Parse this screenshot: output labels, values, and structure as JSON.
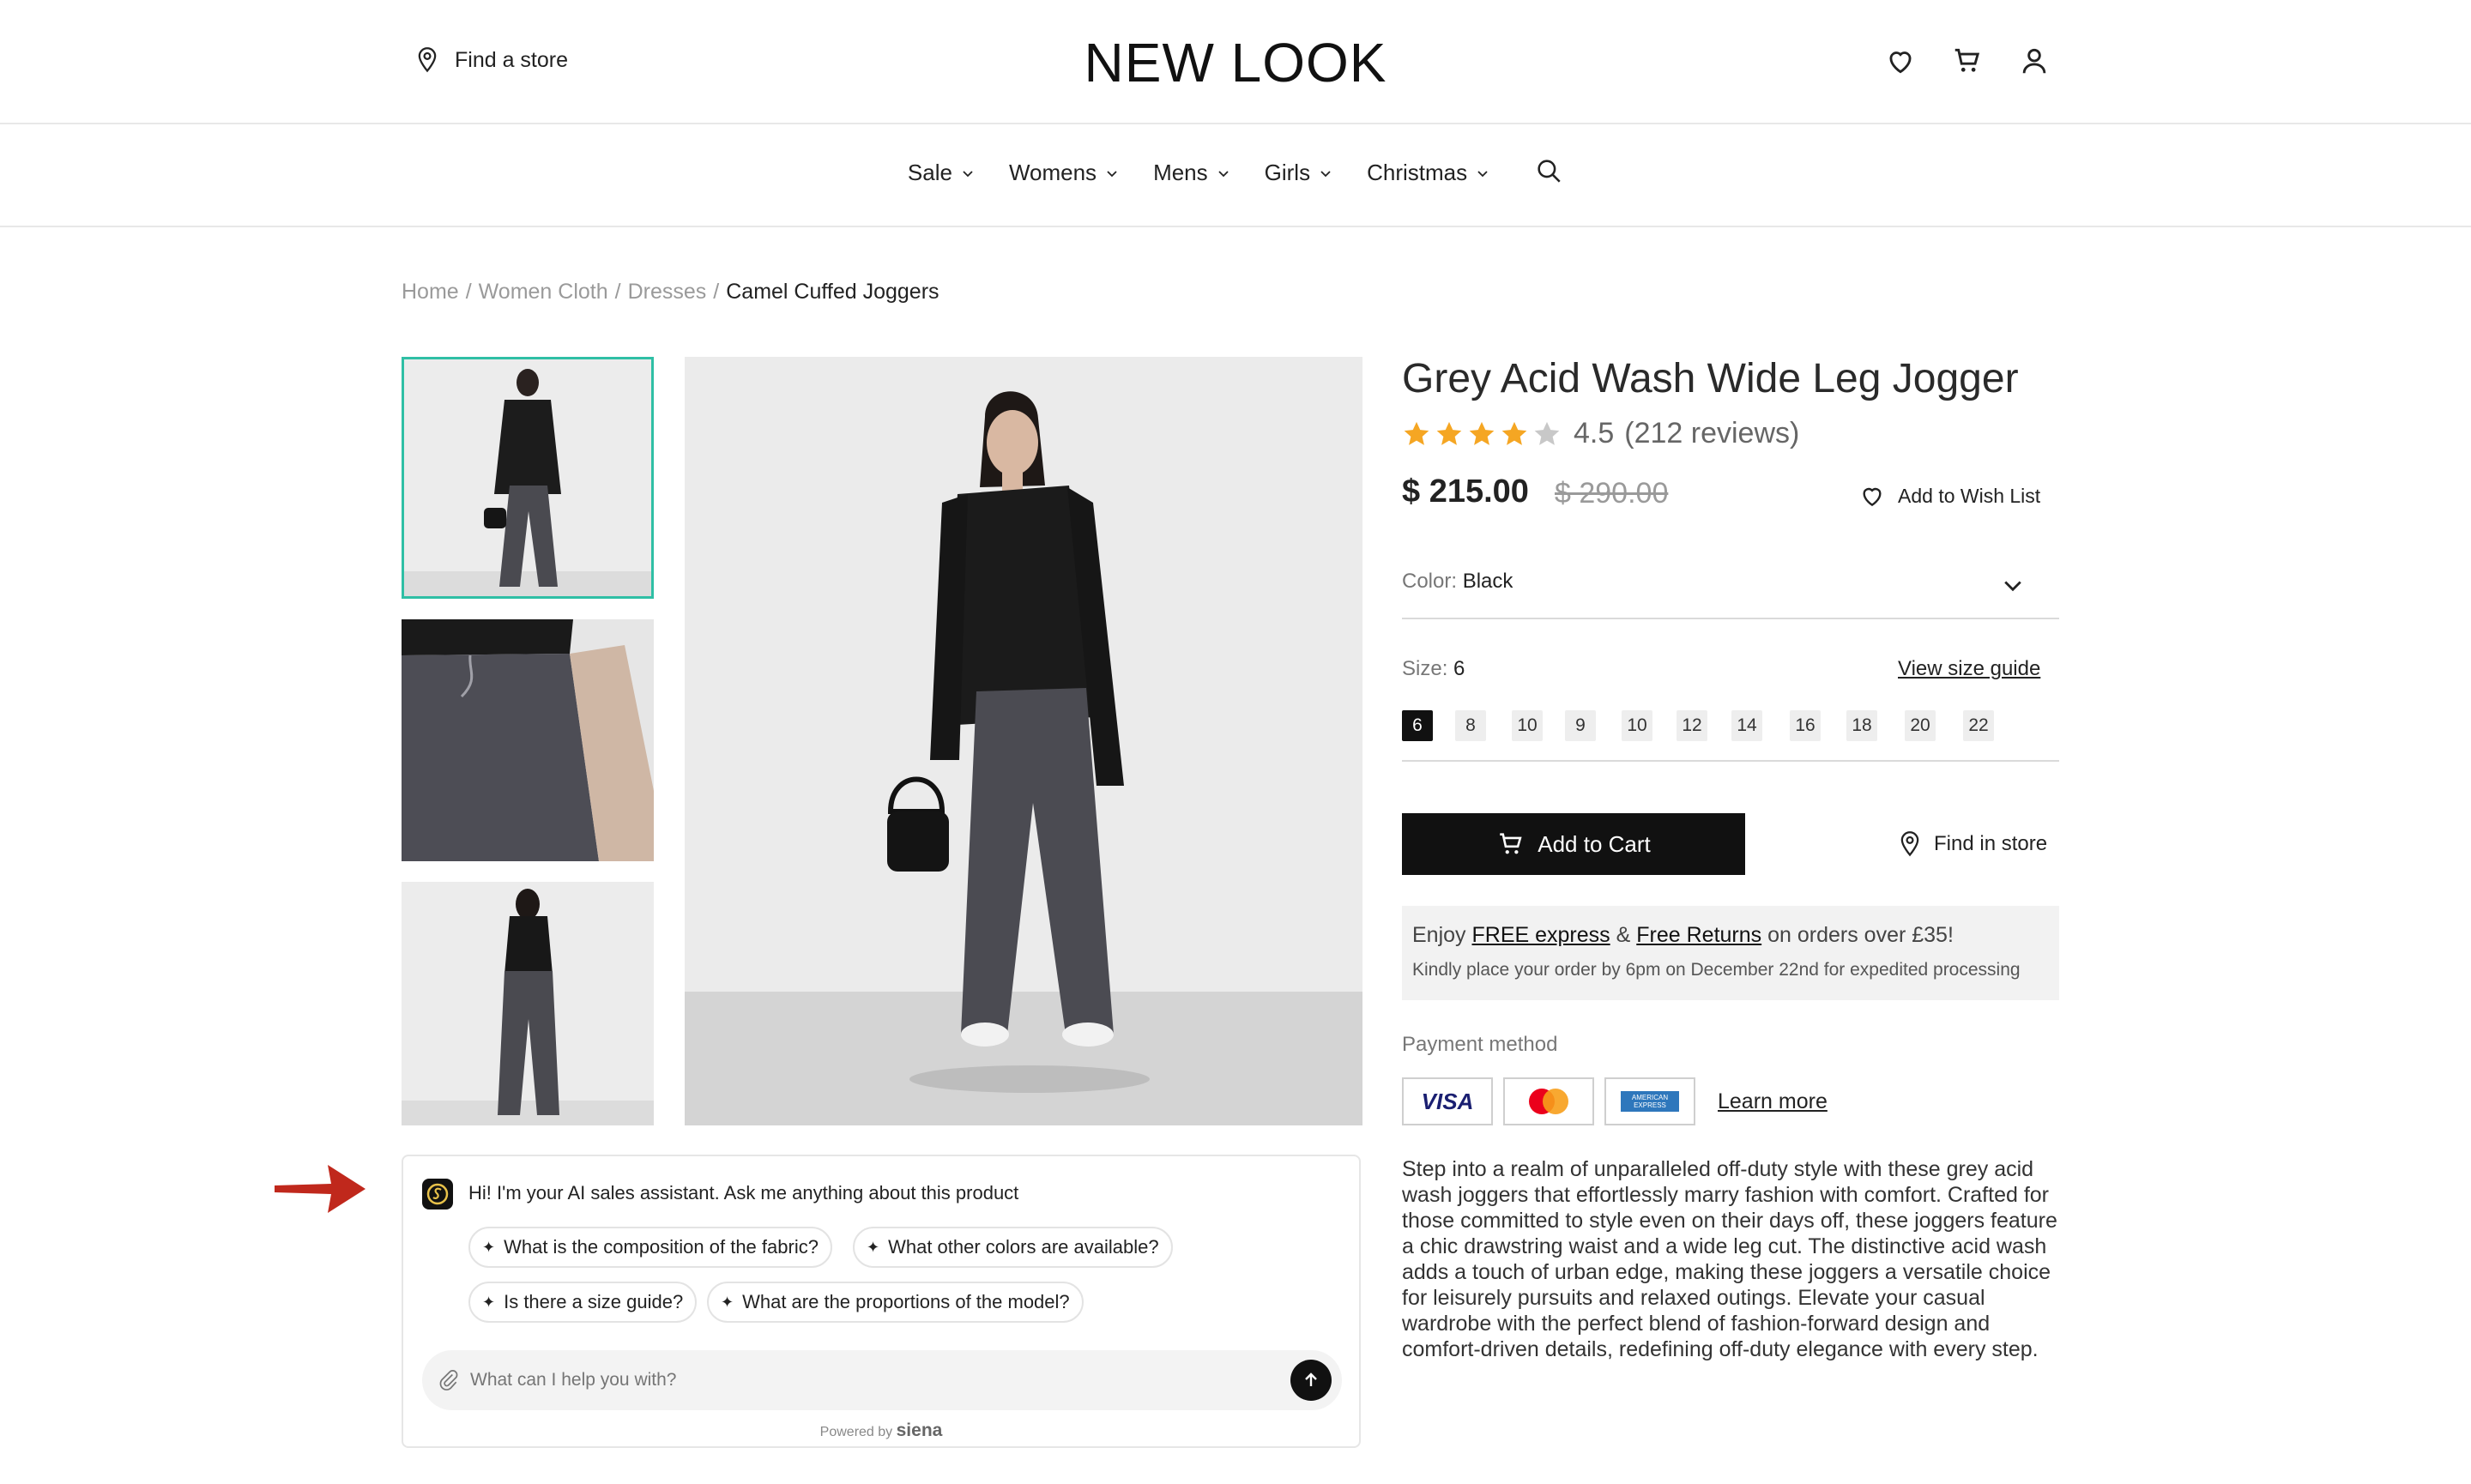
{
  "header": {
    "find_store": "Find a store",
    "logo": "NEW LOOK",
    "icons": [
      "heart-icon",
      "cart-icon",
      "user-icon"
    ]
  },
  "nav": {
    "items": [
      "Sale",
      "Womens",
      "Mens",
      "Girls",
      "Christmas"
    ]
  },
  "breadcrumb": {
    "items": [
      "Home",
      "Women Cloth",
      "Dresses"
    ],
    "current": "Camel Cuffed Joggers",
    "separator": "/"
  },
  "product": {
    "title": "Grey Acid Wash Wide Leg Jogger",
    "rating_value": "4.5",
    "rating_stars": 4.5,
    "reviews": "(212 reviews)",
    "price": "$ 215.00",
    "old_price": "$ 290.00",
    "wishlist": "Add to Wish List",
    "color_label": "Color:",
    "color_value": "Black",
    "size_label": "Size:",
    "size_value": "6",
    "size_guide": "View size guide",
    "sizes": [
      "6",
      "8",
      "10",
      "9",
      "10",
      "12",
      "14",
      "16",
      "18",
      "20",
      "22"
    ],
    "selected_size_index": 0,
    "add_to_cart": "Add to Cart",
    "find_in_store": "Find in store",
    "promo": {
      "enjoy": "Enjoy",
      "free_express": "FREE express",
      "amp": "&",
      "free_returns": "Free Returns",
      "rest": "on orders over £35!",
      "line2": "Kindly place your order by 6pm on December 22nd for expedited processing"
    },
    "payment_label": "Payment method",
    "payment_cards": [
      "VISA",
      "MASTERCARD",
      "AMERICAN EXPRESS"
    ],
    "learn_more": "Learn more",
    "description": "Step into a realm of unparalleled off-duty style with these grey acid wash joggers that effortlessly marry fashion with comfort. Crafted for those committed to style even on their days off, these joggers feature a chic drawstring waist and a wide leg cut. The distinctive acid wash adds a touch of urban edge, making these joggers a versatile choice for leisurely pursuits and relaxed outings. Elevate your casual wardrobe with the perfect blend of fashion-forward design and comfort-driven details, redefining off-duty elegance with every step."
  },
  "chat": {
    "greeting": "Hi! I'm your AI sales assistant. Ask me anything about this product",
    "suggestions": [
      "What is the composition of the fabric?",
      "What other colors are available?",
      "Is there a size guide?",
      "What are the proportions of the model?"
    ],
    "placeholder": "What can I help you with?",
    "powered_by": "Powered by",
    "brand": "siena"
  },
  "colors": {
    "accent_teal": "#2fbfa5",
    "star": "#f5a623",
    "arrow": "#c0281c"
  }
}
